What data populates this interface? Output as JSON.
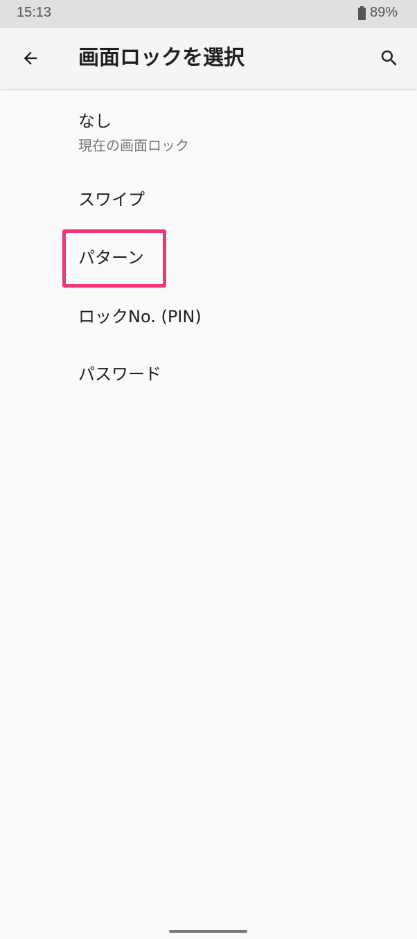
{
  "status_bar": {
    "time": "15:13",
    "battery": "89%"
  },
  "app_bar": {
    "title": "画面ロックを選択",
    "back_icon": "arrow-back-icon",
    "search_icon": "search-icon"
  },
  "options": [
    {
      "label": "なし",
      "subtitle": "現在の画面ロック"
    },
    {
      "label": "スワイプ"
    },
    {
      "label": "パターン",
      "highlighted": true
    },
    {
      "label": "ロックNo. (PIN)"
    },
    {
      "label": "パスワード"
    }
  ],
  "colors": {
    "highlight": "#f0357a",
    "status_bar": "#e0e0e0",
    "background": "#fafafa"
  }
}
